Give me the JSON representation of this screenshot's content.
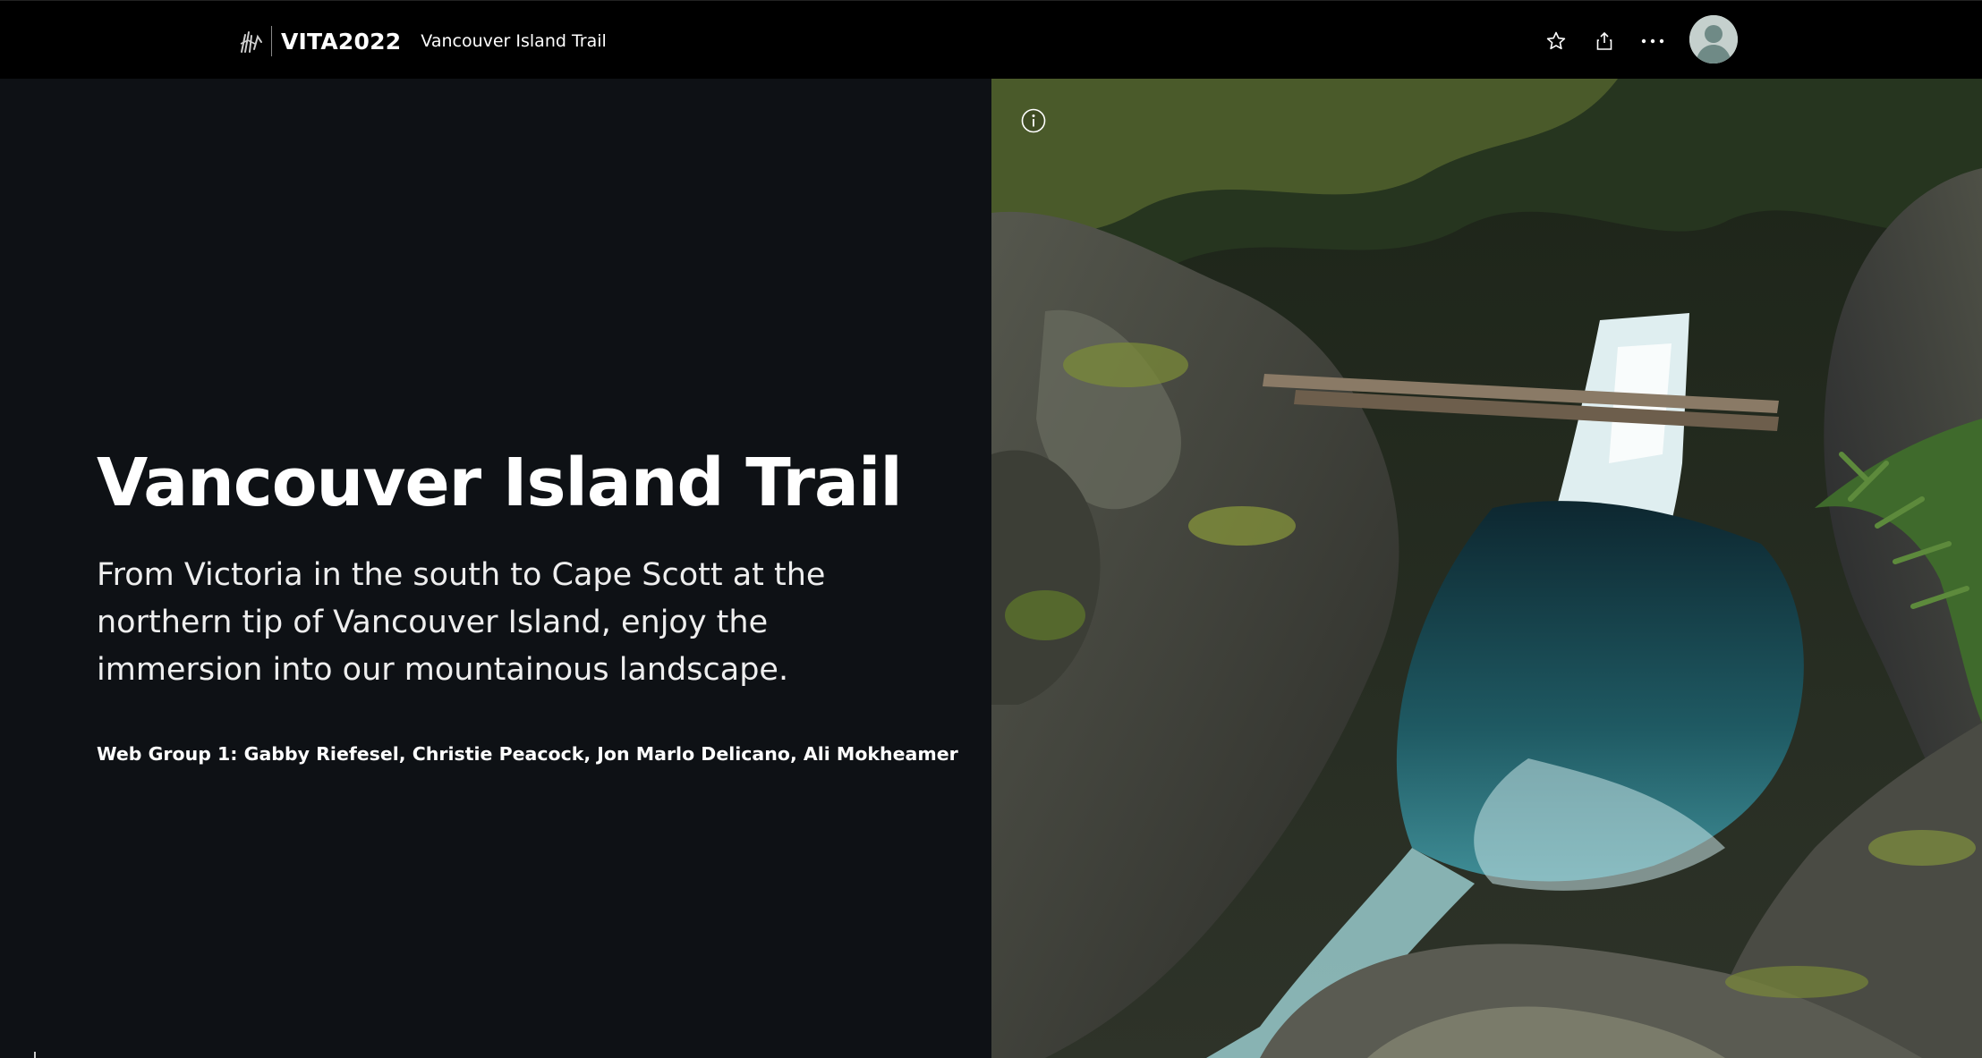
{
  "header": {
    "org_name": "VITA2022",
    "story_title": "Vancouver Island Trail",
    "logo_icon": "hand-logo-icon",
    "actions": [
      {
        "name": "favorite-star-icon"
      },
      {
        "name": "share-icon"
      },
      {
        "name": "more-options-icon"
      },
      {
        "name": "user-avatar"
      }
    ]
  },
  "cover": {
    "title": "Vancouver Island Trail",
    "subtitle": "From Victoria in the south to Cape Scott at the northern tip of Vancouver Island, enjoy the immersion into our mountainous landscape.",
    "byline": "Web Group 1: Gabby Riefesel, Christie Peacock, Jon Marlo Delicano, Ali Mokheamer"
  },
  "media": {
    "image_subject": "waterfall-canyon-with-log-bridge",
    "info_icon": "info-icon"
  },
  "colors": {
    "header_bg": "#000000",
    "panel_bg": "#0e1115",
    "water": "#1f5a63",
    "moss": "#6b7a2e"
  }
}
